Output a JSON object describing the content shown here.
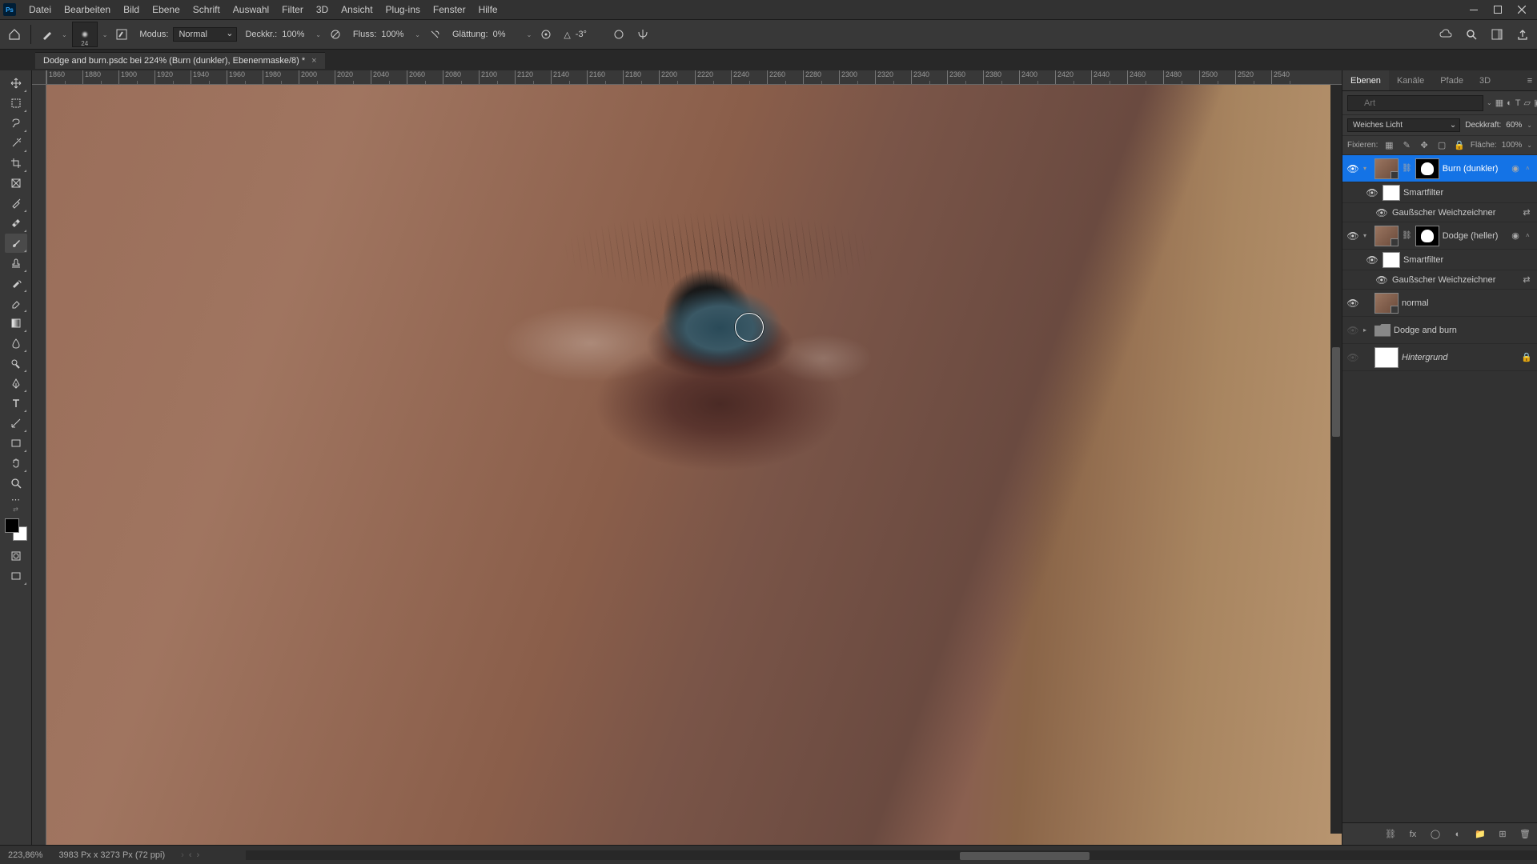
{
  "app": {
    "logo": "Ps"
  },
  "menu": [
    "Datei",
    "Bearbeiten",
    "Bild",
    "Ebene",
    "Schrift",
    "Auswahl",
    "Filter",
    "3D",
    "Ansicht",
    "Plug-ins",
    "Fenster",
    "Hilfe"
  ],
  "options": {
    "brush_size": "24",
    "mode_label": "Modus:",
    "mode_value": "Normal",
    "opacity_label": "Deckkr.:",
    "opacity_value": "100%",
    "flow_label": "Fluss:",
    "flow_value": "100%",
    "smooth_label": "Glättung:",
    "smooth_value": "0%",
    "angle_value": "-3°",
    "angle_icon": "△"
  },
  "document": {
    "tab_title": "Dodge and burn.psdc bei 224% (Burn (dunkler), Ebenenmaske/8) *"
  },
  "ruler_ticks": [
    "1860",
    "1880",
    "1900",
    "1920",
    "1940",
    "1960",
    "1980",
    "2000",
    "2020",
    "2040",
    "2060",
    "2080",
    "2100",
    "2120",
    "2140",
    "2160",
    "2180",
    "2200",
    "2220",
    "2240",
    "2260",
    "2280",
    "2300",
    "2320",
    "2340",
    "2360",
    "2380",
    "2400",
    "2420",
    "2440",
    "2460",
    "2480",
    "2500",
    "2520",
    "2540"
  ],
  "panels": {
    "tabs": [
      "Ebenen",
      "Kanäle",
      "Pfade",
      "3D"
    ],
    "search_placeholder": "Art",
    "blend_mode": "Weiches Licht",
    "opacity_label": "Deckkraft:",
    "opacity_value": "60%",
    "lock_label": "Fixieren:",
    "fill_label": "Fläche:",
    "fill_value": "100%"
  },
  "layers": [
    {
      "name": "Burn (dunkler)",
      "type": "smart-mask",
      "visible": true,
      "selected": true
    },
    {
      "name": "Smartfilter",
      "type": "filter-header",
      "indent": 1
    },
    {
      "name": "Gaußscher Weichzeichner",
      "type": "filter",
      "indent": 2
    },
    {
      "name": "Dodge (heller)",
      "type": "smart-mask",
      "visible": true
    },
    {
      "name": "Smartfilter",
      "type": "filter-header",
      "indent": 1
    },
    {
      "name": "Gaußscher Weichzeichner",
      "type": "filter",
      "indent": 2
    },
    {
      "name": "normal",
      "type": "smart",
      "visible": true
    },
    {
      "name": "Dodge and burn",
      "type": "folder",
      "visible": false
    },
    {
      "name": "Hintergrund",
      "type": "bg",
      "visible": false,
      "locked": true
    }
  ],
  "status": {
    "zoom": "223,86%",
    "doc_info": "3983 Px x 3273 Px (72 ppi)"
  }
}
